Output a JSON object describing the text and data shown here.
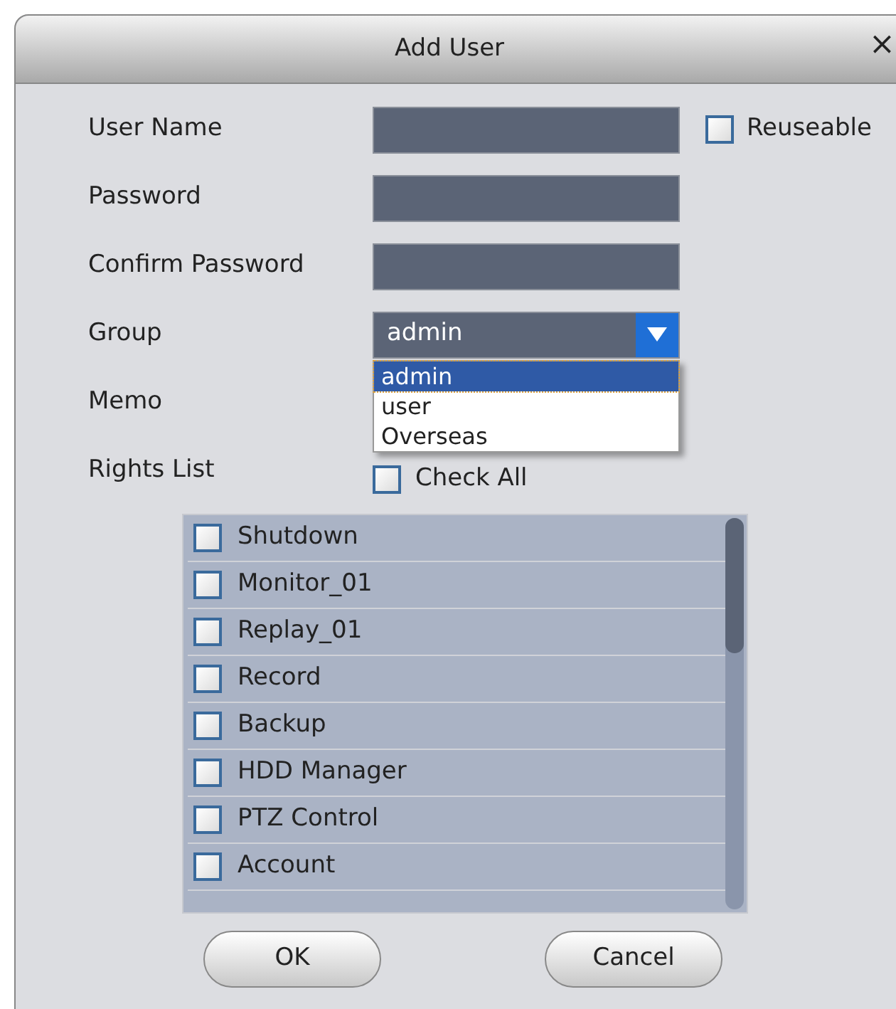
{
  "window": {
    "title": "Add User",
    "close": "×"
  },
  "fields": [
    {
      "label": "User Name",
      "kind": "text"
    },
    {
      "label": "Password",
      "kind": "text"
    },
    {
      "label": "Confirm Password",
      "kind": "text"
    },
    {
      "label": "Group",
      "kind": "select",
      "value": "admin",
      "expanded": true,
      "options": [
        {
          "label": "admin",
          "selected": true
        },
        {
          "label": "user",
          "selected": false
        },
        {
          "label": "Overseas",
          "selected": false
        }
      ]
    },
    {
      "label": "Memo",
      "kind": "hidden"
    },
    {
      "label": "Rights List",
      "kind": "checkall",
      "check_label": "Check All",
      "checked": false
    }
  ],
  "reuseable": {
    "label": "Reuseable",
    "checked": false
  },
  "rights": [
    {
      "label": "Shutdown",
      "checked": false
    },
    {
      "label": "Monitor_01",
      "checked": false
    },
    {
      "label": "Replay_01",
      "checked": false
    },
    {
      "label": "Record",
      "checked": false
    },
    {
      "label": "Backup",
      "checked": false
    },
    {
      "label": "HDD Manager",
      "checked": false
    },
    {
      "label": "PTZ Control",
      "checked": false
    },
    {
      "label": "Account",
      "checked": false
    }
  ],
  "buttons": [
    "OK",
    "Cancel"
  ]
}
